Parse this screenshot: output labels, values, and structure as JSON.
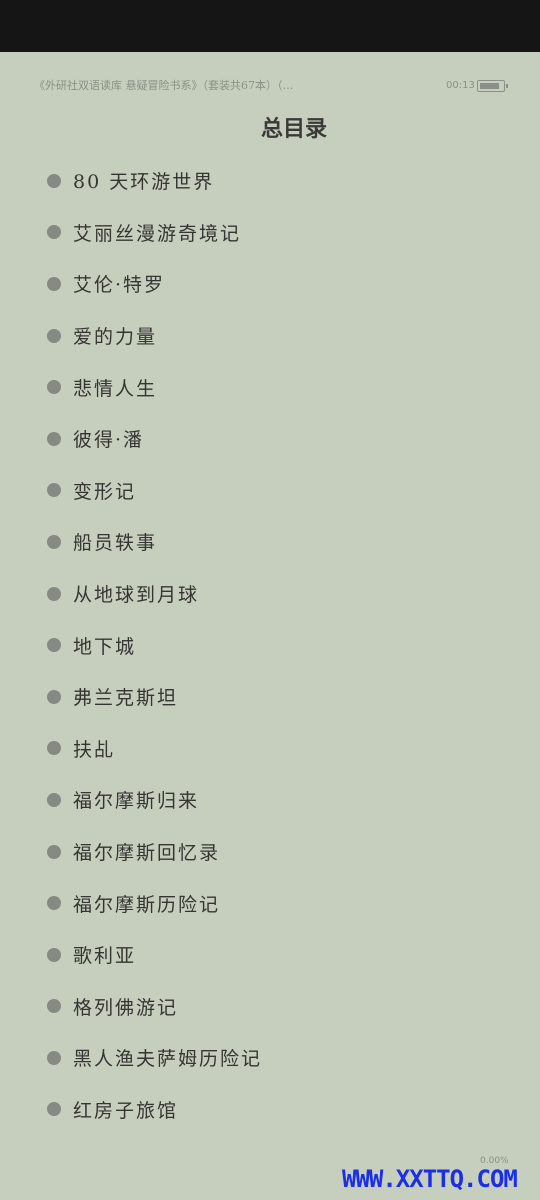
{
  "header": {
    "book_title": "《外研社双语读库 悬疑冒险书系》（套装共67本）（…",
    "time": "00:13",
    "battery_level": 0.85
  },
  "toc": {
    "title": "总目录",
    "items": [
      {
        "label": "80 天环游世界"
      },
      {
        "label": "艾丽丝漫游奇境记"
      },
      {
        "label": "艾伦·特罗"
      },
      {
        "label": "爱的力量"
      },
      {
        "label": "悲情人生"
      },
      {
        "label": "彼得·潘"
      },
      {
        "label": "变形记"
      },
      {
        "label": "船员轶事"
      },
      {
        "label": "从地球到月球"
      },
      {
        "label": "地下城"
      },
      {
        "label": "弗兰克斯坦"
      },
      {
        "label": "扶乩"
      },
      {
        "label": "福尔摩斯归来"
      },
      {
        "label": "福尔摩斯回忆录"
      },
      {
        "label": "福尔摩斯历险记"
      },
      {
        "label": "歌利亚"
      },
      {
        "label": "格列佛游记"
      },
      {
        "label": "黑人渔夫萨姆历险记"
      },
      {
        "label": "红房子旅馆"
      }
    ]
  },
  "footer": {
    "progress": "0.00%",
    "watermark": "WWW.XXTTQ.COM"
  }
}
